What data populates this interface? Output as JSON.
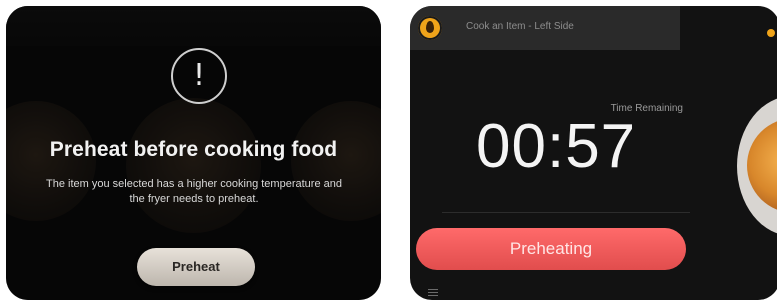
{
  "left_screen": {
    "dialog": {
      "title": "Preheat before cooking food",
      "message": "The item you selected has a higher cooking temperature and the fryer needs to preheat.",
      "button_label": "Preheat",
      "icon": "alert-icon"
    }
  },
  "right_screen": {
    "header": {
      "title": "Cook an Item - Left Side",
      "icon": "flame-icon"
    },
    "time_label": "Time Remaining",
    "timer": "00:57",
    "status_button_label": "Preheating",
    "colors": {
      "accent_red": "#E85656",
      "accent_orange": "#F0A41A"
    }
  }
}
